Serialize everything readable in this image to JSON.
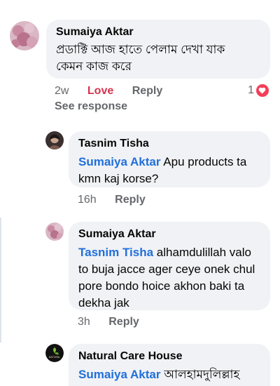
{
  "comments": [
    {
      "author": "Sumaiya Aktar",
      "mention": "",
      "text_line1": "প্রডাক্টি আজ হাতে পেলাম দেখা যাক",
      "text_line2": "কেমন কাজ করে",
      "time": "2w",
      "love_label": "Love",
      "reply_label": "Reply",
      "reaction_count": "1",
      "see_response": "See response"
    },
    {
      "author": "Tasnim Tisha",
      "mention": "Sumaiya Aktar",
      "text_line1": " Apu products ta",
      "text_line2": "kmn kaj korse?",
      "time": "16h",
      "reply_label": "Reply"
    },
    {
      "author": "Sumaiya Aktar",
      "mention": "Tasnim Tisha",
      "text_line1": " alhamdulillah valo",
      "text_line2": "to buja jacce ager ceye onek chul",
      "text_line3": "pore bondo hoice akhon baki ta",
      "text_line4": "dekha jak",
      "time": "3h",
      "reply_label": "Reply"
    },
    {
      "author": "Natural Care House",
      "mention": "Sumaiya Aktar",
      "text_line1": " আলহামদুলিল্লাহ"
    }
  ],
  "avatar_logo_text": "NATURAL",
  "colors": {
    "bubble": "#f0f2f5",
    "mention": "#216fdb",
    "love": "#d6334c",
    "heart": "#f33e58",
    "meta": "#65676b"
  }
}
